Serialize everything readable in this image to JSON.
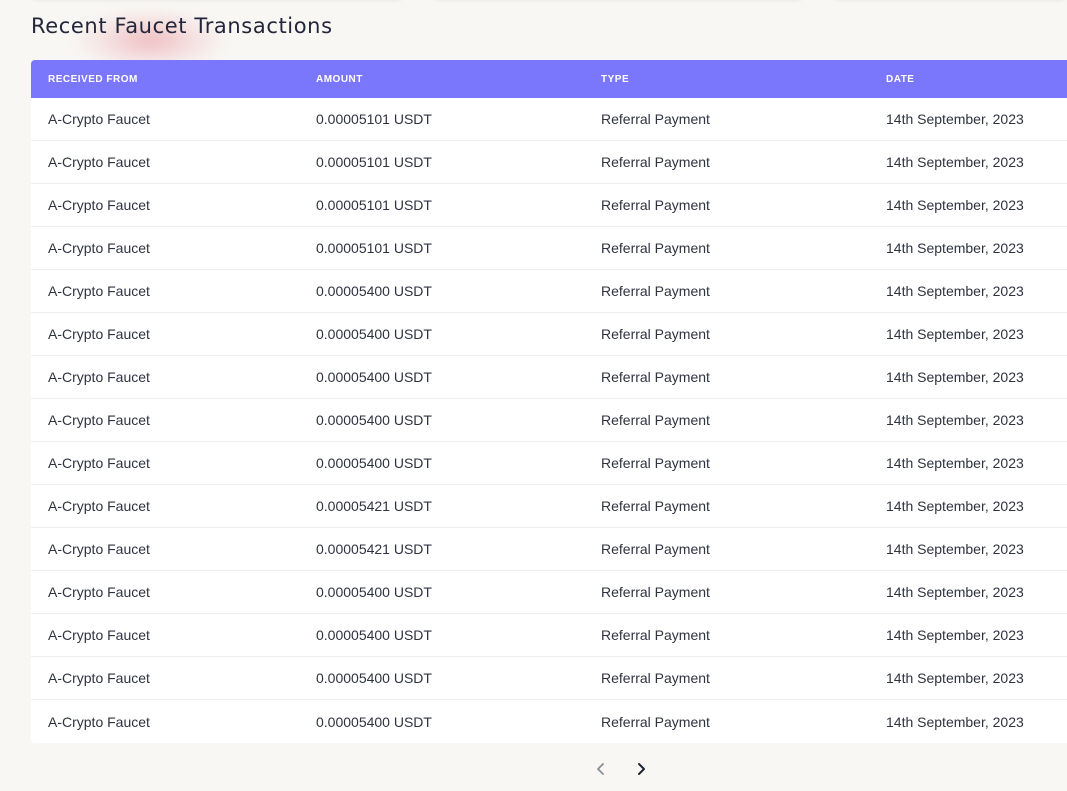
{
  "page": {
    "title": "Recent Faucet Transactions"
  },
  "colors": {
    "header_bg": "#7a77fd",
    "page_bg": "#f8f7f4"
  },
  "table": {
    "headers": [
      "RECEIVED FROM",
      "AMOUNT",
      "TYPE",
      "DATE"
    ],
    "rows": [
      [
        "A-Crypto Faucet",
        "0.00005101 USDT",
        "Referral Payment",
        "14th September, 2023"
      ],
      [
        "A-Crypto Faucet",
        "0.00005101 USDT",
        "Referral Payment",
        "14th September, 2023"
      ],
      [
        "A-Crypto Faucet",
        "0.00005101 USDT",
        "Referral Payment",
        "14th September, 2023"
      ],
      [
        "A-Crypto Faucet",
        "0.00005101 USDT",
        "Referral Payment",
        "14th September, 2023"
      ],
      [
        "A-Crypto Faucet",
        "0.00005400 USDT",
        "Referral Payment",
        "14th September, 2023"
      ],
      [
        "A-Crypto Faucet",
        "0.00005400 USDT",
        "Referral Payment",
        "14th September, 2023"
      ],
      [
        "A-Crypto Faucet",
        "0.00005400 USDT",
        "Referral Payment",
        "14th September, 2023"
      ],
      [
        "A-Crypto Faucet",
        "0.00005400 USDT",
        "Referral Payment",
        "14th September, 2023"
      ],
      [
        "A-Crypto Faucet",
        "0.00005400 USDT",
        "Referral Payment",
        "14th September, 2023"
      ],
      [
        "A-Crypto Faucet",
        "0.00005421 USDT",
        "Referral Payment",
        "14th September, 2023"
      ],
      [
        "A-Crypto Faucet",
        "0.00005421 USDT",
        "Referral Payment",
        "14th September, 2023"
      ],
      [
        "A-Crypto Faucet",
        "0.00005400 USDT",
        "Referral Payment",
        "14th September, 2023"
      ],
      [
        "A-Crypto Faucet",
        "0.00005400 USDT",
        "Referral Payment",
        "14th September, 2023"
      ],
      [
        "A-Crypto Faucet",
        "0.00005400 USDT",
        "Referral Payment",
        "14th September, 2023"
      ],
      [
        "A-Crypto Faucet",
        "0.00005400 USDT",
        "Referral Payment",
        "14th September, 2023"
      ]
    ]
  },
  "pagination": {
    "prev_icon": "chevron-left-icon",
    "next_icon": "chevron-right-icon"
  }
}
